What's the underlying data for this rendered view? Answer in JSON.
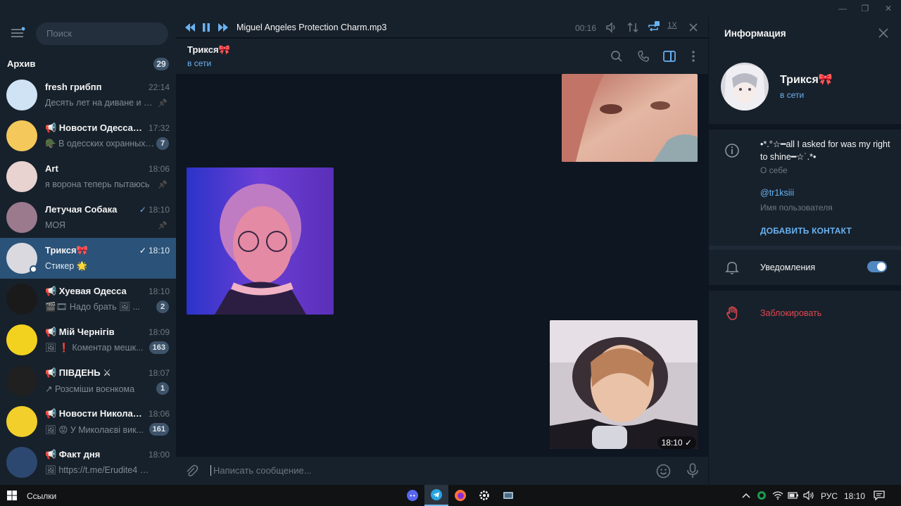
{
  "window": {
    "minimize": "—",
    "maximize": "❐",
    "close": "✕"
  },
  "sidebar": {
    "search_placeholder": "Поиск",
    "archive": {
      "label": "Архив",
      "count": "29"
    },
    "chats": [
      {
        "name": "fresh грибпп",
        "time": "22:14",
        "message": "Десять лет на диване и х...",
        "pinned": true,
        "avatar_color": "#cfe3f5"
      },
      {
        "name": "📢 Новости Одесса | ...",
        "time": "17:32",
        "message": "🪖 В одесских охранных ...",
        "badge": "7",
        "avatar_color": "#f4c85a"
      },
      {
        "name": "Art",
        "time": "18:06",
        "message": "я ворона теперь пытаюсь",
        "pinned": true,
        "avatar_color": "#e8d3d0"
      },
      {
        "name": "Летучая Собака",
        "time": "18:10",
        "message": "МОЯ",
        "pinned": true,
        "read": true,
        "avatar_color": "#9a7a8c"
      },
      {
        "name": "Трикся🎀",
        "time": "18:10",
        "message": "Стикер 🌟",
        "read": true,
        "active": true,
        "avatar_color": "#d9d9df"
      },
      {
        "name": "📢 Хуевая Одесса",
        "time": "18:10",
        "message": "🎬🎞 Надо брать 🖼 ...",
        "badge": "2",
        "avatar_color": "#1a1a1a"
      },
      {
        "name": "📢 Мій Чернігів",
        "time": "18:09",
        "message": "🖼 ❗ Коментар мешк...",
        "badge": "163",
        "avatar_color": "#f2d21f"
      },
      {
        "name": "📢 ПІВДЕНЬ ⚔",
        "time": "18:07",
        "message": "↗ Розсміши воєнкома",
        "badge": "1",
        "avatar_color": "#202020"
      },
      {
        "name": "📢 Новости Николае...",
        "time": "18:06",
        "message": "🖼 😡 У Миколаєві вик...",
        "badge": "161",
        "avatar_color": "#f2cf2a"
      },
      {
        "name": "📢 Факт дня",
        "time": "18:00",
        "message": "🖼 https://t.me/Erudite4 🔥 ...",
        "avatar_color": "#2c4870"
      }
    ]
  },
  "player": {
    "title": "Miguel Angeles Protection Charm.mp3",
    "time": "00:16",
    "speed": "1X"
  },
  "chat_header": {
    "name": "Трикся🎀",
    "status": "в сети"
  },
  "messages": {
    "last_time": "18:10"
  },
  "composer": {
    "placeholder": "Написать сообщение..."
  },
  "info": {
    "title": "Информация",
    "name": "Трикся🎀",
    "status": "в сети",
    "bio": "•*.°☆━all I asked for was my right to shine━☆˙.*•",
    "bio_label": "О себе",
    "username": "@tr1ksiii",
    "username_label": "Имя пользователя",
    "add_contact": "ДОБАВИТЬ КОНТАКТ",
    "notifications": "Уведомления",
    "notifications_on": true,
    "block": "Заблокировать"
  },
  "taskbar": {
    "links": "Ссылки",
    "lang": "РУС",
    "clock": "18:10"
  },
  "colors": {
    "accent": "#6ab2f2",
    "active_chat": "#2b5278",
    "danger": "#e0484f",
    "bg": "#0e1621",
    "panel": "#17212b"
  }
}
